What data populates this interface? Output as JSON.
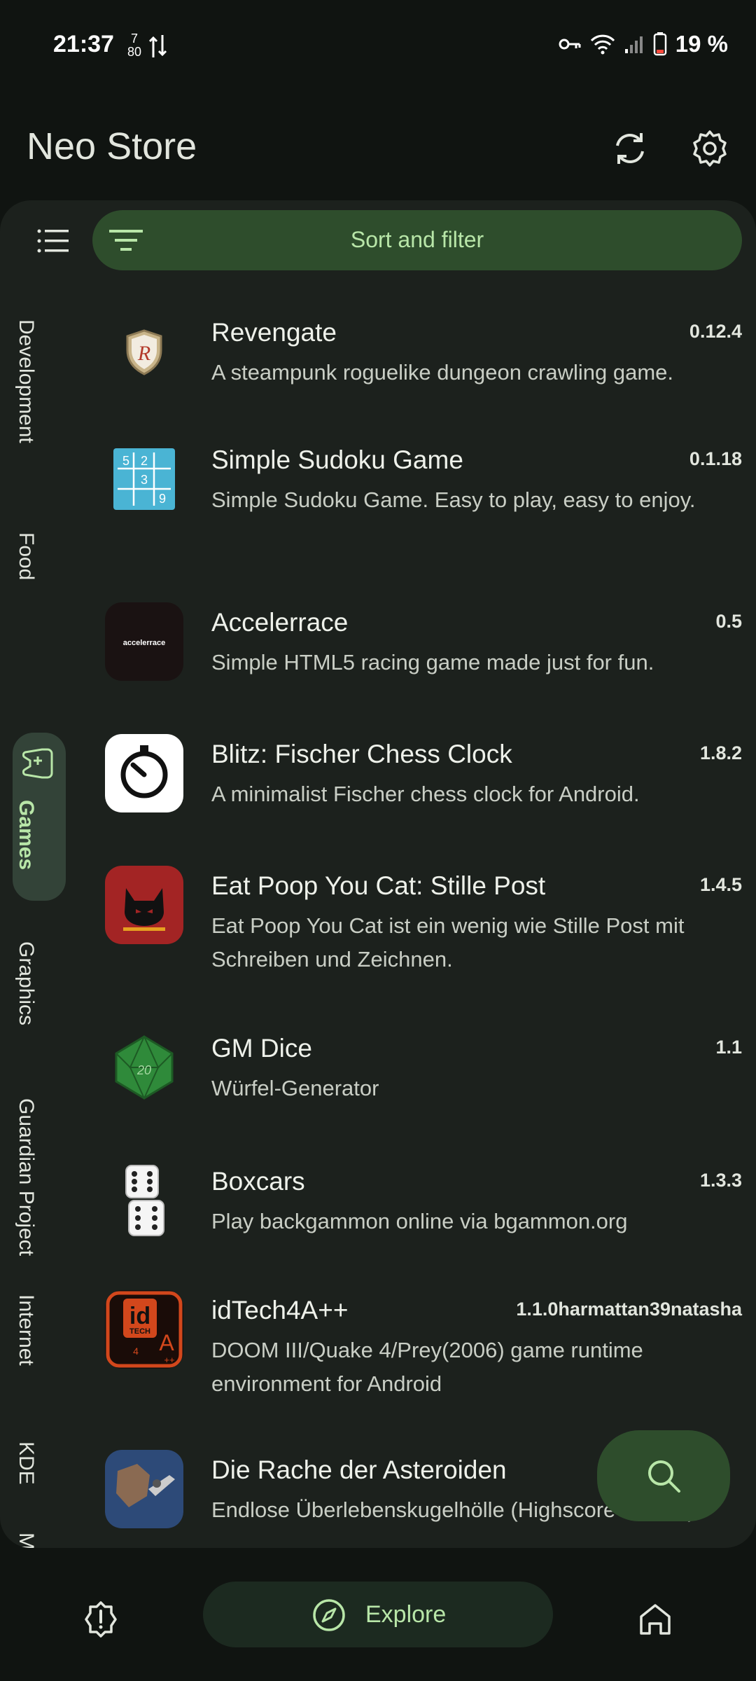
{
  "status_bar": {
    "time": "21:37",
    "net_top": "7",
    "net_bottom": "80",
    "battery": "19 %"
  },
  "app_bar": {
    "title": "Neo Store",
    "sync_icon": "sync-icon",
    "settings_icon": "gear-icon"
  },
  "toolbar": {
    "sort_filter_label": "Sort and filter"
  },
  "categories": {
    "development": "Development",
    "food": "Food",
    "games": "Games",
    "graphics": "Graphics",
    "guardian": "Guardian Project",
    "internet": "Internet",
    "kde": "KDE",
    "messaging": "Messaging",
    "selected": "Games"
  },
  "apps": [
    {
      "name": "Revengate",
      "version": "0.12.4",
      "description": "A steampunk roguelike dungeon crawling game."
    },
    {
      "name": "Simple Sudoku Game",
      "version": "0.1.18",
      "description": "Simple Sudoku Game. Easy to play, easy to enjoy."
    },
    {
      "name": "Accelerrace",
      "version": "0.5",
      "description": "Simple HTML5 racing game made just for fun."
    },
    {
      "name": "Blitz: Fischer Chess Clock",
      "version": "1.8.2",
      "description": "A minimalist Fischer chess clock for Android."
    },
    {
      "name": "Eat Poop You Cat: Stille Post",
      "version": "1.4.5",
      "description": "Eat Poop You Cat ist ein wenig wie Stille Post mit Schreiben und Zeichnen."
    },
    {
      "name": "GM Dice",
      "version": "1.1",
      "description": "Würfel-Generator"
    },
    {
      "name": "Boxcars",
      "version": "1.3.3",
      "description": "Play backgammon online via bgammon.org"
    },
    {
      "name": "idTech4A++",
      "version": "1.1.0harmattan39natasha",
      "description": "DOOM III/Quake 4/Prey(2006) game runtime environment for Android"
    },
    {
      "name": "Die Rache der Asteroiden",
      "version": "",
      "description": "Endlose Überlebenskugelhölle (Highscore-basiert)"
    }
  ],
  "icon_texts": {
    "sudoku_digits": [
      "5",
      "2",
      "3",
      "9"
    ],
    "accelerrace_logo": "accelerrace",
    "gmdice_face": "20",
    "idtech_logo": "id",
    "idtech_sub": "TECH",
    "idtech_num": "4",
    "idtech_a": "A",
    "idtech_plus": "++"
  },
  "fab": {
    "icon": "search-icon"
  },
  "bottom_nav": {
    "left_icon": "alert-icon",
    "explore_label": "Explore",
    "explore_icon": "compass-icon",
    "right_icon": "home-icon"
  },
  "colors": {
    "background": "#101411",
    "panel": "#1c211d",
    "accent_container": "#2e4d2c",
    "accent_text": "#b8e6a8"
  }
}
